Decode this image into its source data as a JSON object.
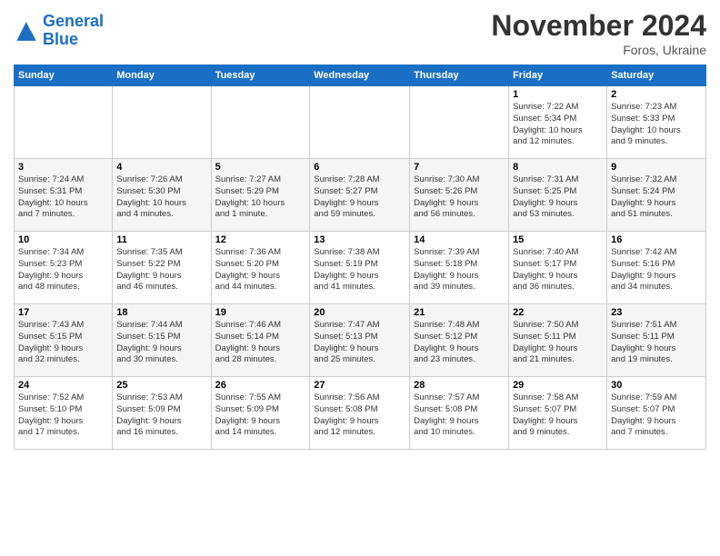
{
  "logo": {
    "line1": "General",
    "line2": "Blue"
  },
  "header": {
    "month": "November 2024",
    "location": "Foros, Ukraine"
  },
  "weekdays": [
    "Sunday",
    "Monday",
    "Tuesday",
    "Wednesday",
    "Thursday",
    "Friday",
    "Saturday"
  ],
  "weeks": [
    [
      {
        "day": "",
        "info": ""
      },
      {
        "day": "",
        "info": ""
      },
      {
        "day": "",
        "info": ""
      },
      {
        "day": "",
        "info": ""
      },
      {
        "day": "",
        "info": ""
      },
      {
        "day": "1",
        "info": "Sunrise: 7:22 AM\nSunset: 5:34 PM\nDaylight: 10 hours\nand 12 minutes."
      },
      {
        "day": "2",
        "info": "Sunrise: 7:23 AM\nSunset: 5:33 PM\nDaylight: 10 hours\nand 9 minutes."
      }
    ],
    [
      {
        "day": "3",
        "info": "Sunrise: 7:24 AM\nSunset: 5:31 PM\nDaylight: 10 hours\nand 7 minutes."
      },
      {
        "day": "4",
        "info": "Sunrise: 7:26 AM\nSunset: 5:30 PM\nDaylight: 10 hours\nand 4 minutes."
      },
      {
        "day": "5",
        "info": "Sunrise: 7:27 AM\nSunset: 5:29 PM\nDaylight: 10 hours\nand 1 minute."
      },
      {
        "day": "6",
        "info": "Sunrise: 7:28 AM\nSunset: 5:27 PM\nDaylight: 9 hours\nand 59 minutes."
      },
      {
        "day": "7",
        "info": "Sunrise: 7:30 AM\nSunset: 5:26 PM\nDaylight: 9 hours\nand 56 minutes."
      },
      {
        "day": "8",
        "info": "Sunrise: 7:31 AM\nSunset: 5:25 PM\nDaylight: 9 hours\nand 53 minutes."
      },
      {
        "day": "9",
        "info": "Sunrise: 7:32 AM\nSunset: 5:24 PM\nDaylight: 9 hours\nand 51 minutes."
      }
    ],
    [
      {
        "day": "10",
        "info": "Sunrise: 7:34 AM\nSunset: 5:23 PM\nDaylight: 9 hours\nand 48 minutes."
      },
      {
        "day": "11",
        "info": "Sunrise: 7:35 AM\nSunset: 5:22 PM\nDaylight: 9 hours\nand 46 minutes."
      },
      {
        "day": "12",
        "info": "Sunrise: 7:36 AM\nSunset: 5:20 PM\nDaylight: 9 hours\nand 44 minutes."
      },
      {
        "day": "13",
        "info": "Sunrise: 7:38 AM\nSunset: 5:19 PM\nDaylight: 9 hours\nand 41 minutes."
      },
      {
        "day": "14",
        "info": "Sunrise: 7:39 AM\nSunset: 5:18 PM\nDaylight: 9 hours\nand 39 minutes."
      },
      {
        "day": "15",
        "info": "Sunrise: 7:40 AM\nSunset: 5:17 PM\nDaylight: 9 hours\nand 36 minutes."
      },
      {
        "day": "16",
        "info": "Sunrise: 7:42 AM\nSunset: 5:16 PM\nDaylight: 9 hours\nand 34 minutes."
      }
    ],
    [
      {
        "day": "17",
        "info": "Sunrise: 7:43 AM\nSunset: 5:15 PM\nDaylight: 9 hours\nand 32 minutes."
      },
      {
        "day": "18",
        "info": "Sunrise: 7:44 AM\nSunset: 5:15 PM\nDaylight: 9 hours\nand 30 minutes."
      },
      {
        "day": "19",
        "info": "Sunrise: 7:46 AM\nSunset: 5:14 PM\nDaylight: 9 hours\nand 28 minutes."
      },
      {
        "day": "20",
        "info": "Sunrise: 7:47 AM\nSunset: 5:13 PM\nDaylight: 9 hours\nand 25 minutes."
      },
      {
        "day": "21",
        "info": "Sunrise: 7:48 AM\nSunset: 5:12 PM\nDaylight: 9 hours\nand 23 minutes."
      },
      {
        "day": "22",
        "info": "Sunrise: 7:50 AM\nSunset: 5:11 PM\nDaylight: 9 hours\nand 21 minutes."
      },
      {
        "day": "23",
        "info": "Sunrise: 7:51 AM\nSunset: 5:11 PM\nDaylight: 9 hours\nand 19 minutes."
      }
    ],
    [
      {
        "day": "24",
        "info": "Sunrise: 7:52 AM\nSunset: 5:10 PM\nDaylight: 9 hours\nand 17 minutes."
      },
      {
        "day": "25",
        "info": "Sunrise: 7:53 AM\nSunset: 5:09 PM\nDaylight: 9 hours\nand 16 minutes."
      },
      {
        "day": "26",
        "info": "Sunrise: 7:55 AM\nSunset: 5:09 PM\nDaylight: 9 hours\nand 14 minutes."
      },
      {
        "day": "27",
        "info": "Sunrise: 7:56 AM\nSunset: 5:08 PM\nDaylight: 9 hours\nand 12 minutes."
      },
      {
        "day": "28",
        "info": "Sunrise: 7:57 AM\nSunset: 5:08 PM\nDaylight: 9 hours\nand 10 minutes."
      },
      {
        "day": "29",
        "info": "Sunrise: 7:58 AM\nSunset: 5:07 PM\nDaylight: 9 hours\nand 9 minutes."
      },
      {
        "day": "30",
        "info": "Sunrise: 7:59 AM\nSunset: 5:07 PM\nDaylight: 9 hours\nand 7 minutes."
      }
    ]
  ]
}
